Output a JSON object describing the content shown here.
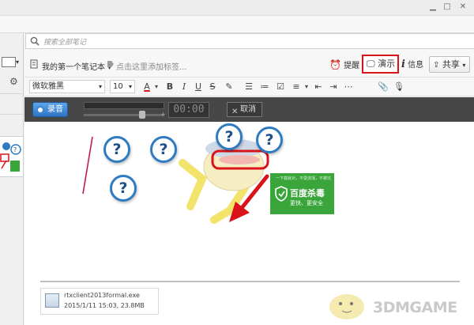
{
  "search": {
    "placeholder": "搜索全部笔记"
  },
  "note": {
    "notebook_name": "我的第一个笔记本",
    "tag_hint": "点击这里添加标签..."
  },
  "header_actions": {
    "reminder": "提醒",
    "present": "演示",
    "info": "信息",
    "share": "共享"
  },
  "format_toolbar": {
    "font_family": "微软雅黑",
    "font_size": "10"
  },
  "recording_bar": {
    "record_label": "录音",
    "timer": "00:00",
    "cancel_label": "取消"
  },
  "ad_card": {
    "top_text": "一下载就对，不耍流氓，不被坑",
    "title": "百度杀毒",
    "subtitle": "更快、更安全"
  },
  "attachment": {
    "filename": "rtxclient2013formal.exe",
    "meta": "2015/1/11 15:03, 23.8MB"
  },
  "watermark": "3DMGAME",
  "colors": {
    "highlight_red": "#d8141a",
    "record_blue": "#2e74c6",
    "bubble_blue": "#2f7bc2",
    "ad_green": "#3aa53a",
    "recbar_bg": "#474747"
  }
}
